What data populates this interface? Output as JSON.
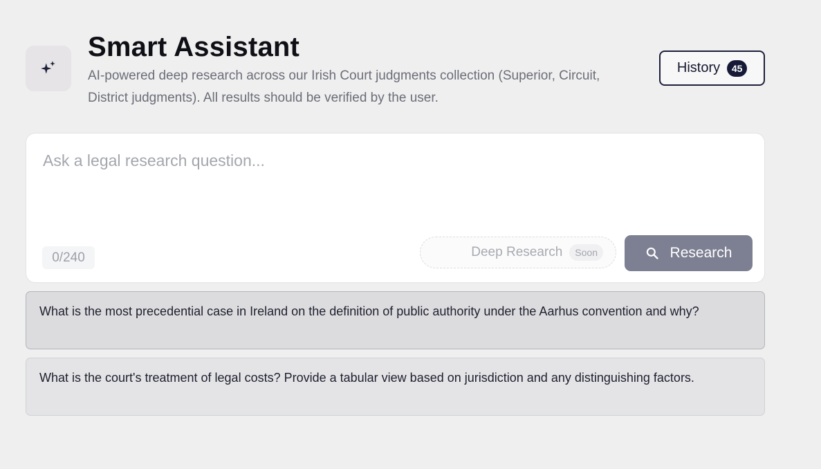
{
  "header": {
    "title": "Smart Assistant",
    "subtitle": "AI-powered deep research across our Irish Court judgments collection (Superior, Circuit, District judgments). All results should be verified by the user.",
    "logo_icon": "sparkles-icon",
    "history_label": "History",
    "history_count": "45"
  },
  "query": {
    "placeholder": "Ask a legal research question...",
    "value": "",
    "char_count": "0/240",
    "deep_research_label": "Deep Research",
    "deep_research_badge": "Soon",
    "research_label": "Research",
    "research_icon": "search-icon"
  },
  "suggestions": [
    {
      "text": "What is the most precedential case in Ireland on the definition of public authority under the Aarhus convention and why?"
    },
    {
      "text": "What is the court's treatment of legal costs? Provide a tabular view based on jurisdiction and any distinguishing factors."
    }
  ],
  "colors": {
    "accent_dark": "#161a36",
    "research_button": "#7d7f92",
    "background": "#efefef"
  }
}
